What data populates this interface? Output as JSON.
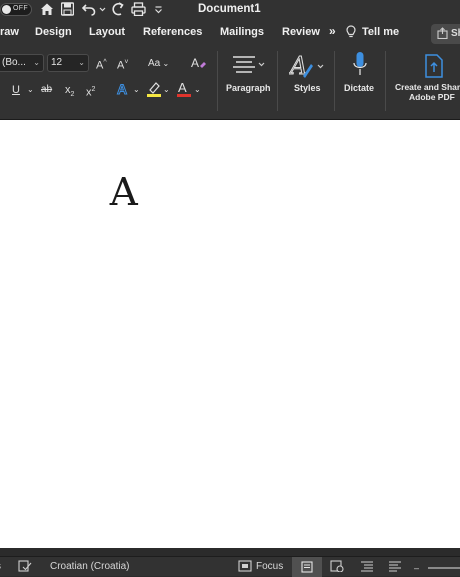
{
  "titlebar": {
    "autosave_label": "OFF",
    "document_title": "Document1"
  },
  "tabs": [
    {
      "label": "raw"
    },
    {
      "label": "Design"
    },
    {
      "label": "Layout"
    },
    {
      "label": "References"
    },
    {
      "label": "Mailings"
    },
    {
      "label": "Review"
    }
  ],
  "tabs_extra": {
    "overflow": "»",
    "tell_me": "Tell me",
    "share": "Sh"
  },
  "ribbon": {
    "font_name": "(Bo...",
    "font_size": "12",
    "grow_font": "A^",
    "shrink_font": "A˅",
    "change_case": "Aa",
    "paragraph_label": "Paragraph",
    "styles_label": "Styles",
    "dictate_label": "Dictate",
    "adobe_label_line1": "Create and Share",
    "adobe_label_line2": "Adobe PDF"
  },
  "document": {
    "content": "A"
  },
  "statusbar": {
    "language": "Croatian (Croatia)",
    "focus": "Focus"
  },
  "colors": {
    "highlight": "#f5e642",
    "font_color": "#e0342c",
    "text_effects": "#3d8fe0",
    "dictate": "#3d8fe0",
    "adobe": "#3d8fe0"
  }
}
